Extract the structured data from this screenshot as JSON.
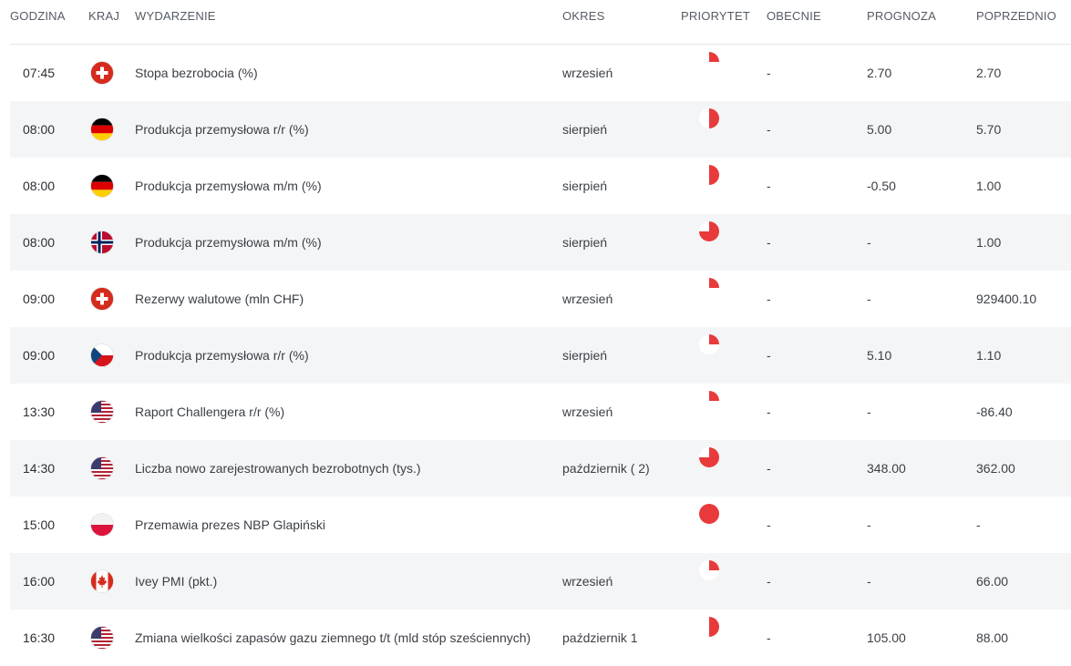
{
  "columns": {
    "time": "GODZINA",
    "country": "KRAJ",
    "event": "WYDARZENIE",
    "period": "OKRES",
    "priority": "PRIORYTET",
    "current": "OBECNIE",
    "forecast": "PROGNOZA",
    "previous": "POPRZEDNIO"
  },
  "colors": {
    "priority": "#e83a3a"
  },
  "rows": [
    {
      "time": "07:45",
      "flag": "switzerland-flag-icon",
      "event": "Stopa bezrobocia (%)",
      "period": "wrzesień",
      "priority": 0.25,
      "current": "-",
      "forecast": "2.70",
      "previous": "2.70"
    },
    {
      "time": "08:00",
      "flag": "germany-flag-icon",
      "event": "Produkcja przemysłowa r/r (%)",
      "period": "sierpień",
      "priority": 0.5,
      "current": "-",
      "forecast": "5.00",
      "previous": "5.70"
    },
    {
      "time": "08:00",
      "flag": "germany-flag-icon",
      "event": "Produkcja przemysłowa m/m (%)",
      "period": "sierpień",
      "priority": 0.5,
      "current": "-",
      "forecast": "-0.50",
      "previous": "1.00"
    },
    {
      "time": "08:00",
      "flag": "norway-flag-icon",
      "event": "Produkcja przemysłowa m/m (%)",
      "period": "sierpień",
      "priority": 0.75,
      "current": "-",
      "forecast": "-",
      "previous": "1.00"
    },
    {
      "time": "09:00",
      "flag": "switzerland-flag-icon",
      "event": "Rezerwy walutowe (mln CHF)",
      "period": "wrzesień",
      "priority": 0.25,
      "current": "-",
      "forecast": "-",
      "previous": "929400.10"
    },
    {
      "time": "09:00",
      "flag": "czech-flag-icon",
      "event": "Produkcja przemysłowa r/r (%)",
      "period": "sierpień",
      "priority": 0.25,
      "current": "-",
      "forecast": "5.10",
      "previous": "1.10"
    },
    {
      "time": "13:30",
      "flag": "usa-flag-icon",
      "event": "Raport Challengera r/r (%)",
      "period": "wrzesień",
      "priority": 0.25,
      "current": "-",
      "forecast": "-",
      "previous": "-86.40"
    },
    {
      "time": "14:30",
      "flag": "usa-flag-icon",
      "event": "Liczba nowo zarejestrowanych bezrobotnych (tys.)",
      "period": "październik ( 2)",
      "priority": 0.75,
      "current": "-",
      "forecast": "348.00",
      "previous": "362.00"
    },
    {
      "time": "15:00",
      "flag": "poland-flag-icon",
      "event": "Przemawia prezes NBP Glapiński",
      "period": "",
      "priority": 1.0,
      "current": "-",
      "forecast": "-",
      "previous": "-"
    },
    {
      "time": "16:00",
      "flag": "canada-flag-icon",
      "event": "Ivey PMI (pkt.)",
      "period": "wrzesień",
      "priority": 0.25,
      "current": "-",
      "forecast": "-",
      "previous": "66.00"
    },
    {
      "time": "16:30",
      "flag": "usa-flag-icon",
      "event": "Zmiana wielkości zapasów gazu ziemnego t/t (mld stóp sześciennych)",
      "period": "październik 1",
      "priority": 0.5,
      "current": "-",
      "forecast": "105.00",
      "previous": "88.00"
    }
  ]
}
